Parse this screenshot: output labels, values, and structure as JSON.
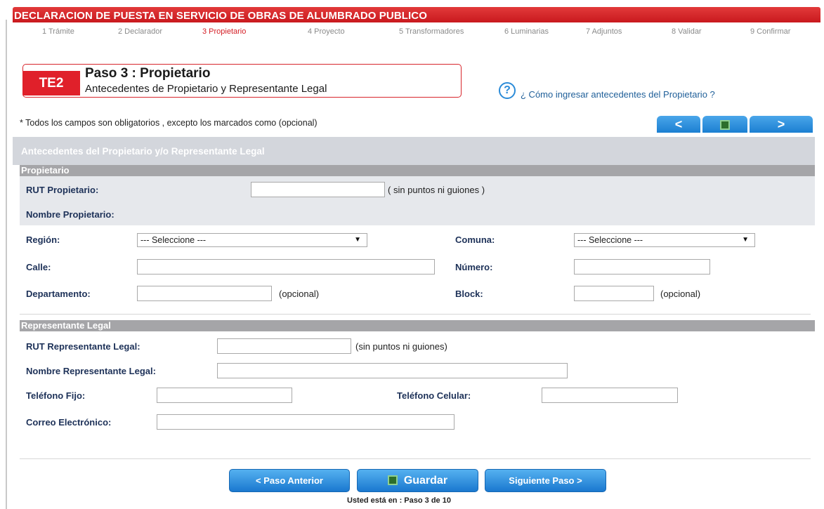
{
  "header": {
    "title": "DECLARACION DE PUESTA EN SERVICIO DE OBRAS DE ALUMBRADO PUBLICO"
  },
  "steps": [
    {
      "label": "1 Trámite",
      "active": false
    },
    {
      "label": "2 Declarador",
      "active": false
    },
    {
      "label": "3 Propietario",
      "active": true
    },
    {
      "label": "4 Proyecto",
      "active": false
    },
    {
      "label": "5 Transformadores",
      "active": false
    },
    {
      "label": "6 Luminarias",
      "active": false
    },
    {
      "label": "7 Adjuntos",
      "active": false
    },
    {
      "label": "8 Validar",
      "active": false
    },
    {
      "label": "9 Confirmar",
      "active": false
    }
  ],
  "form_header": {
    "badge": "TE2",
    "title": "Paso 3 : Propietario",
    "subtitle": "Antecedentes de Propietario y Representante Legal"
  },
  "help": {
    "icon": "question-circle-icon",
    "text": "¿ Cómo ingresar antecedentes del Propietario ?"
  },
  "required_note": "* Todos los campos son obligatorios , excepto los marcados como (opcional)",
  "top_nav": {
    "prev": "<",
    "next": ">",
    "save_icon": "save-disk-icon"
  },
  "section_title": "Antecedentes del Propietario y/o Representante Legal",
  "propietario": {
    "heading": "Propietario",
    "rut_label": "RUT Propietario:",
    "rut_value": "",
    "rut_hint": "( sin puntos ni guiones )",
    "nombre_label": "Nombre Propietario:",
    "region_label": "Región:",
    "region_value": "--- Seleccione ---",
    "comuna_label": "Comuna:",
    "comuna_value": "--- Seleccione ---",
    "calle_label": "Calle:",
    "numero_label": "Número:",
    "depto_label": "Departamento:",
    "depto_hint": "(opcional)",
    "block_label": "Block:",
    "block_hint": "(opcional)"
  },
  "representante": {
    "heading": "Representante Legal",
    "rut_label": "RUT Representante Legal:",
    "rut_hint": "(sin puntos ni guiones)",
    "nombre_label": "Nombre Representante Legal:",
    "fijo_label": "Teléfono Fijo:",
    "celular_label": "Teléfono Celular:",
    "correo_label": "Correo Electrónico:"
  },
  "footer": {
    "prev_label": "< Paso Anterior",
    "save_label": "Guardar",
    "next_label": "Siguiente Paso >",
    "status": "Usted está en : Paso 3 de 10"
  },
  "colors": {
    "brand_red": "#d41d24",
    "button_blue": "#1b7fd2",
    "label_navy": "#1d3158"
  }
}
